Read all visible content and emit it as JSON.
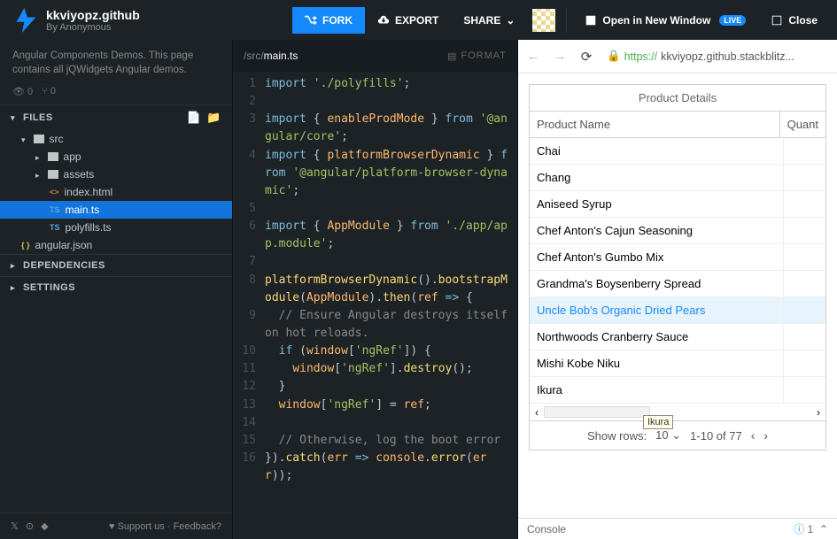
{
  "header": {
    "project_title": "kkviyopz.github",
    "project_subtitle": "By Anonymous",
    "fork_label": "FORK",
    "export_label": "EXPORT",
    "share_label": "SHARE",
    "open_window_label": "Open in New Window",
    "live_badge": "LIVE",
    "close_label": "Close"
  },
  "sidebar": {
    "description": "Angular Components Demos. This page contains all jQWidgets Angular demos.",
    "views": "0",
    "forks": "0",
    "files_label": "FILES",
    "deps_label": "DEPENDENCIES",
    "settings_label": "SETTINGS",
    "tree": {
      "root": "src",
      "app": "app",
      "assets": "assets",
      "index": "index.html",
      "main": "main.ts",
      "polyfills": "polyfills.ts",
      "angular": "angular.json"
    },
    "footer": {
      "support": "Support us",
      "feedback": "Feedback?"
    }
  },
  "editor": {
    "path_prefix": "/src/",
    "filename": "main.ts",
    "format_label": "FORMAT",
    "code": {
      "l1": "import './polyfills';",
      "l3a": "import { enableProdMode } from",
      "l3b": "'@angular/core';",
      "l4a": "import { platformBrowserDynamic }",
      "l4b": "from",
      "l4c": "'@angular/platform-browser-dynamic';",
      "l6a": "import { AppModule } from",
      "l6b": "'./app/app.module';",
      "l8": "platformBrowserDynamic()",
      "l8b": ".bootstrapModule(AppModule).then(ref => {",
      "l9a": "  // Ensure Angular destroys",
      "l9b": "itself on hot reloads.",
      "l10": "  if (window['ngRef']) {",
      "l11": "    window['ngRef'].destroy();",
      "l12": "  }",
      "l13": "  window['ngRef'] = ref;",
      "l15a": "  // Otherwise, log the boot",
      "l15b": "error",
      "l16a": "}).catch(err => console.error",
      "l16b": "(err));"
    }
  },
  "preview": {
    "url_proto": "https://",
    "url_rest": "kkviyopz.github.stackblitz...",
    "tooltip": "Ikura",
    "grid": {
      "title": "Product Details",
      "col1": "Product Name",
      "col2": "Quant",
      "rows": [
        "Chai",
        "Chang",
        "Aniseed Syrup",
        "Chef Anton's Cajun Seasoning",
        "Chef Anton's Gumbo Mix",
        "Grandma's Boysenberry Spread",
        "Uncle Bob's Organic Dried Pears",
        "Northwoods Cranberry Sauce",
        "Mishi Kobe Niku",
        "Ikura"
      ],
      "pager_show": "Show rows:",
      "pager_size": "10",
      "pager_range": "1-10 of 77"
    }
  },
  "console": {
    "label": "Console",
    "count": "1"
  }
}
